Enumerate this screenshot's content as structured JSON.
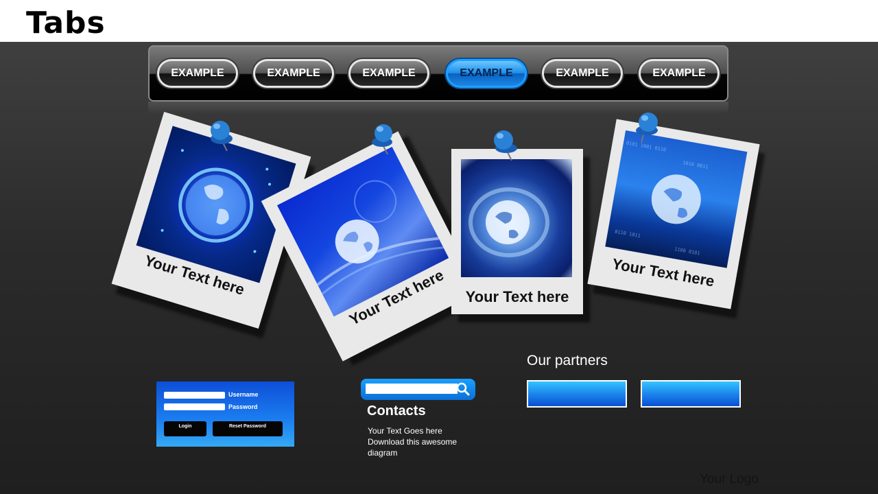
{
  "header": {
    "title": "Tabs"
  },
  "tabs": [
    {
      "label": "EXAMPLE",
      "active": false
    },
    {
      "label": "EXAMPLE",
      "active": false
    },
    {
      "label": "EXAMPLE",
      "active": false
    },
    {
      "label": "EXAMPLE",
      "active": true
    },
    {
      "label": "EXAMPLE",
      "active": false
    },
    {
      "label": "EXAMPLE",
      "active": false
    }
  ],
  "photos": [
    {
      "caption": "Your Text here",
      "image": "globe-circuit"
    },
    {
      "caption": "Your Text here",
      "image": "globe-lightstreaks"
    },
    {
      "caption": "Your Text here",
      "image": "globe-swirl"
    },
    {
      "caption": "Your Text here",
      "image": "globe-binary"
    }
  ],
  "login": {
    "username_label": "Username",
    "password_label": "Password",
    "login_button": "Login",
    "reset_button": "Reset Password"
  },
  "search": {
    "placeholder": "",
    "icon": "search-icon"
  },
  "contacts": {
    "title": "Contacts",
    "line1": "Your Text  Goes here",
    "line2": "Download this awesome",
    "line3": "diagram"
  },
  "partners": {
    "title": "Our partners",
    "count": 2
  },
  "footer": {
    "logo_text": "Your  Logo"
  },
  "colors": {
    "accent": "#1a8fe8",
    "background": "#2b2b2b",
    "pin": "#1f74c9"
  }
}
